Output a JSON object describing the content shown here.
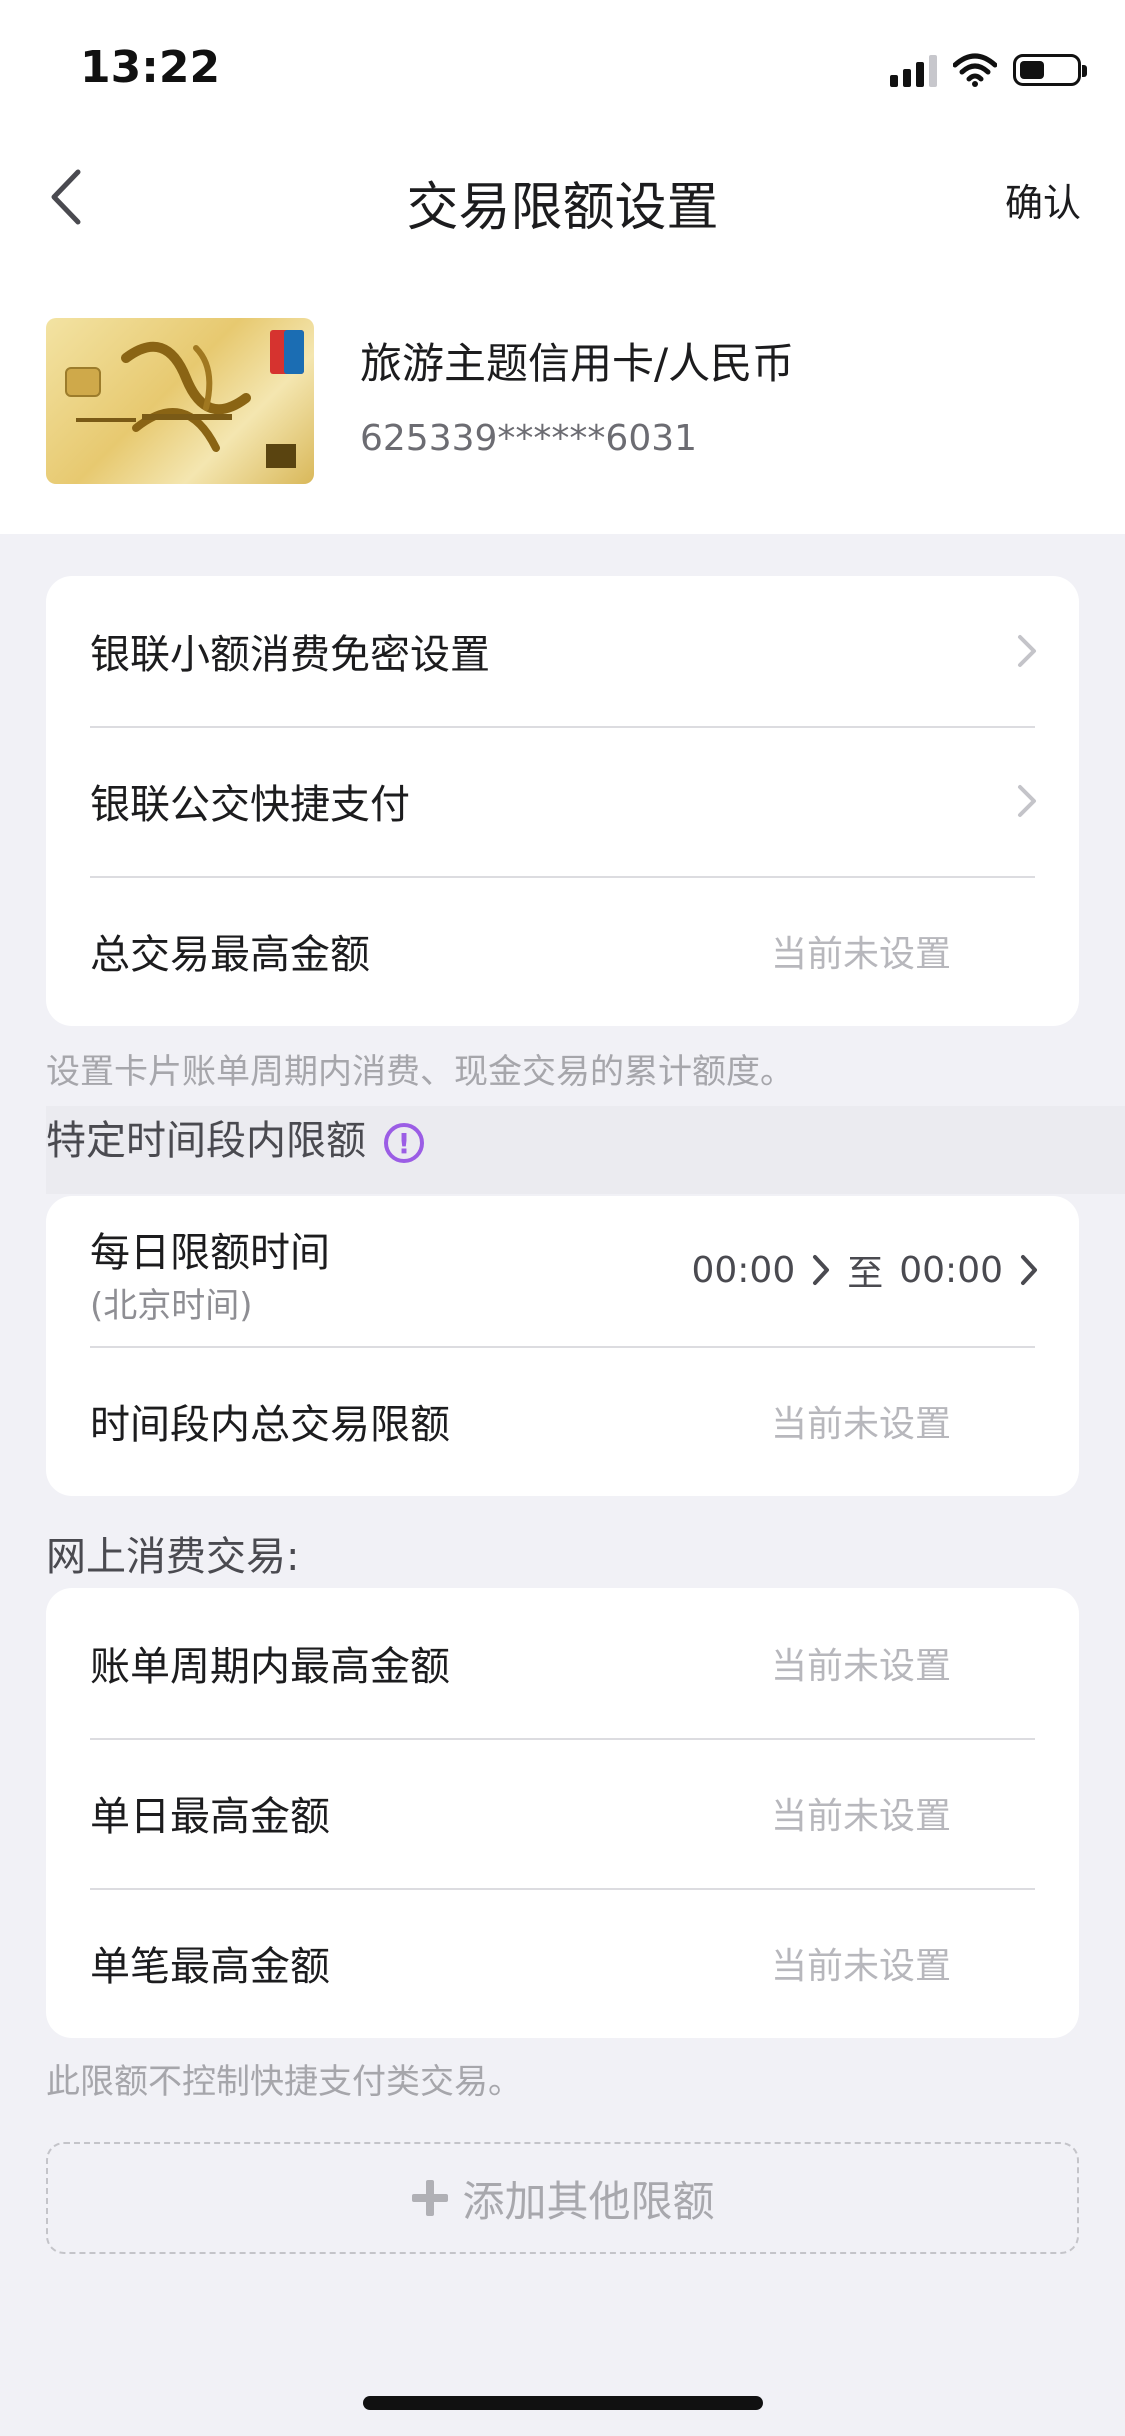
{
  "status_bar": {
    "time": "13:22"
  },
  "nav": {
    "title": "交易限额设置",
    "confirm_label": "确认"
  },
  "card": {
    "name": "旅游主题信用卡/人民币",
    "number": "625339******6031"
  },
  "group1": {
    "items": [
      {
        "label": "银联小额消费免密设置"
      },
      {
        "label": "银联公交快捷支付"
      },
      {
        "label": "总交易最高金额",
        "value": "当前未设置"
      }
    ],
    "note": "设置卡片账单周期内消费、现金交易的累计额度。"
  },
  "section_time": {
    "title": "特定时间段内限额",
    "daily_label": "每日限额时间",
    "daily_sub": "(北京时间)",
    "start": "00:00",
    "to": "至",
    "end": "00:00",
    "total_label": "时间段内总交易限额",
    "total_value": "当前未设置"
  },
  "section_online": {
    "title": "网上消费交易:",
    "items": [
      {
        "label": "账单周期内最高金额",
        "value": "当前未设置"
      },
      {
        "label": "单日最高金额",
        "value": "当前未设置"
      },
      {
        "label": "单笔最高金额",
        "value": "当前未设置"
      }
    ],
    "note": "此限额不控制快捷支付类交易。"
  },
  "add_button": {
    "label": "添加其他限额"
  },
  "colors": {
    "accent": "#9b5de5",
    "background": "#f1f1f6",
    "muted": "#b7b7bc"
  }
}
